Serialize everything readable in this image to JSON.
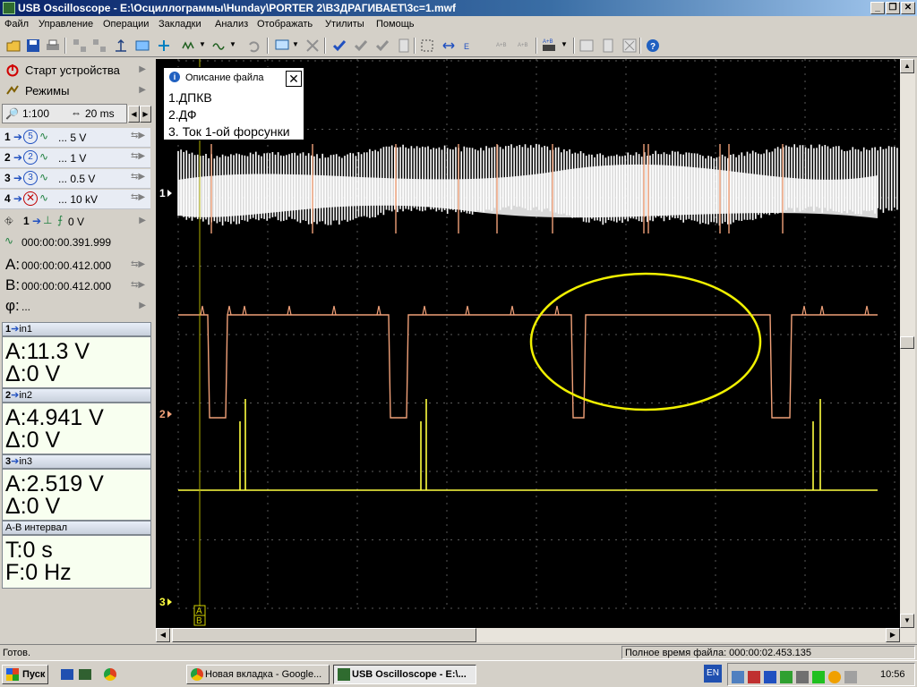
{
  "window": {
    "title": "USB Oscilloscope - E:\\Осциллограммы\\Hunday\\PORTER 2\\ВЗДРАГИВАЕТ\\3с=1.mwf",
    "btn_min": "_",
    "btn_max": "❐",
    "btn_close": "✕"
  },
  "menu": [
    "Файл",
    "Управление",
    "Операции",
    "Закладки",
    "Анализ",
    "Отображать",
    "Утилиты",
    "Помощь"
  ],
  "left_panel": {
    "start_device": "Старт устройства",
    "modes": "Режимы",
    "zoom": "1:100",
    "timebase": "20 ms",
    "channels": [
      {
        "num": "1",
        "badge": "5",
        "range": "... 5 V",
        "color": "#000"
      },
      {
        "num": "2",
        "badge": "2",
        "range": "... 1 V",
        "color": "#000"
      },
      {
        "num": "3",
        "badge": "3",
        "range": "... 0.5 V",
        "color": "#000"
      },
      {
        "num": "4",
        "badge": "",
        "range": "... 10 kV",
        "color": "#000"
      }
    ],
    "trigger_channel": "1",
    "trigger_level": "0 V",
    "trigger_time": "000:00:00.391.999",
    "cursor_a_label": "A:",
    "cursor_a": "000:00:00.412.000",
    "cursor_b_label": "B:",
    "cursor_b": "000:00:00.412.000",
    "phi_label": "φ:",
    "phi": "..."
  },
  "measurements": [
    {
      "header": "in1",
      "num": "1",
      "a": "A:11.3 V",
      "d": "Δ:0 V"
    },
    {
      "header": "in2",
      "num": "2",
      "a": "A:4.941 V",
      "d": "Δ:0 V"
    },
    {
      "header": "in3",
      "num": "3",
      "a": "A:2.519 V",
      "d": "Δ:0 V"
    }
  ],
  "interval": {
    "header": "A-B интервал",
    "t": "T:0 s",
    "f": "F:0 Hz"
  },
  "popup": {
    "title": "Описание файла",
    "lines": [
      "1.ДПКВ",
      "2.ДФ",
      "3. Ток 1-ой форсунки"
    ]
  },
  "scope": {
    "ch_markers": [
      {
        "label": "1"
      },
      {
        "label": "2"
      },
      {
        "label": "3"
      }
    ],
    "cursor_labels": [
      "A",
      "B"
    ],
    "colors": {
      "ch1": "#ffffff",
      "ch2": "#f0a078",
      "ch3": "#ffff40",
      "grid": "#5a5a5a",
      "highlight": "#f0f000"
    }
  },
  "status": {
    "left": "Готов.",
    "file_time": "Полное время файла: 000:00:02.453.135"
  },
  "taskbar": {
    "start": "Пуск",
    "tasks": [
      "Новая вкладка - Google...",
      "USB Oscilloscope - E:\\..."
    ],
    "lang": "EN",
    "clock": "10:56"
  }
}
